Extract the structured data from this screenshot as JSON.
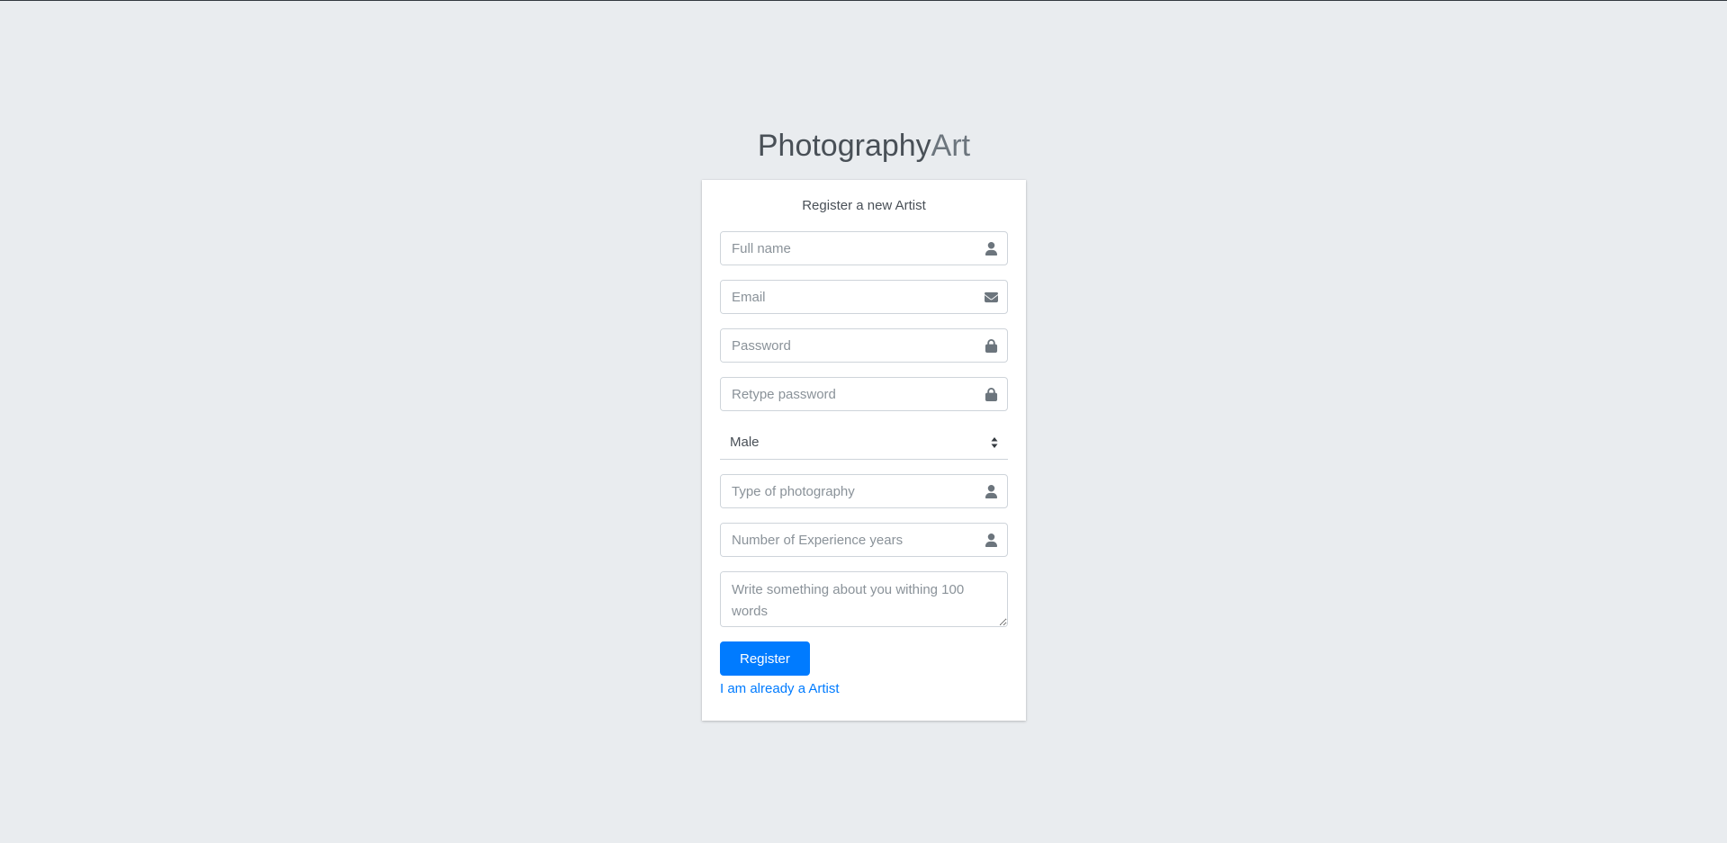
{
  "brand": {
    "name_bold": "Photography",
    "name_light": "Art"
  },
  "form": {
    "title": "Register a new Artist",
    "full_name": {
      "placeholder": "Full name",
      "icon": "user-icon"
    },
    "email": {
      "placeholder": "Email",
      "icon": "envelope-icon"
    },
    "password": {
      "placeholder": "Password",
      "icon": "lock-icon"
    },
    "retype_password": {
      "placeholder": "Retype password",
      "icon": "lock-icon"
    },
    "gender": {
      "selected": "Male",
      "options": [
        "Male"
      ]
    },
    "photography_type": {
      "placeholder": "Type of photography",
      "icon": "user-icon"
    },
    "experience_years": {
      "placeholder": "Number of Experience years",
      "icon": "user-icon"
    },
    "about": {
      "placeholder": "Write something about you withing 100 words"
    },
    "register_label": "Register",
    "login_link": "I am already a Artist"
  },
  "colors": {
    "background": "#e9ecef",
    "accent": "#007bff",
    "card": "#ffffff"
  }
}
